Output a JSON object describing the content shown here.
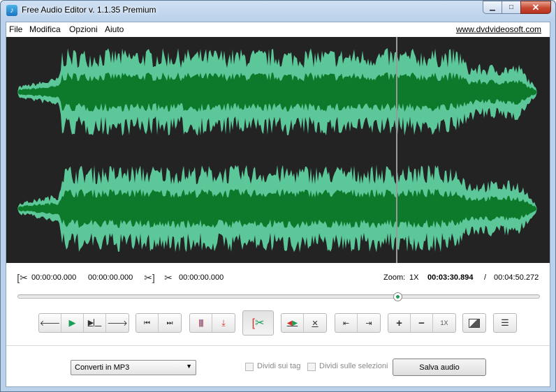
{
  "window": {
    "title": "Free Audio Editor v. 1.1.35 Premium",
    "app_icon": "music-note-icon",
    "controls": {
      "minimize": "minimize-icon",
      "maximize": "maximize-icon",
      "close": "close-icon"
    }
  },
  "menu": {
    "items": [
      "File",
      "Modifica",
      "Opzioni",
      "Aiuto"
    ],
    "site_link": "www.dvdvideosoft.com"
  },
  "waveform": {
    "background": "#232323",
    "dark_green": "#0c7a2a",
    "light_green": "#5cc89a",
    "playhead_position": 0.775
  },
  "info": {
    "selection_start": "00:00:00.000",
    "selection_end": "00:00:00.000",
    "cut_length": "00:00:00.000",
    "zoom_label": "Zoom:",
    "zoom_value": "1X",
    "current_time": "00:03:30.894",
    "separator": "/",
    "total_time": "00:04:50.272"
  },
  "position_slider": {
    "value": 0.7257
  },
  "toolbar": {
    "zoom_reset_label": "1X",
    "accent_red": "#d4302b",
    "accent_green": "#1aa056"
  },
  "bottom": {
    "format_select": "Converti in MP3",
    "split_tags_label": "Dividi sui tag",
    "split_selection_label": "Dividi sulle selezioni",
    "save_button": "Salva audio"
  }
}
